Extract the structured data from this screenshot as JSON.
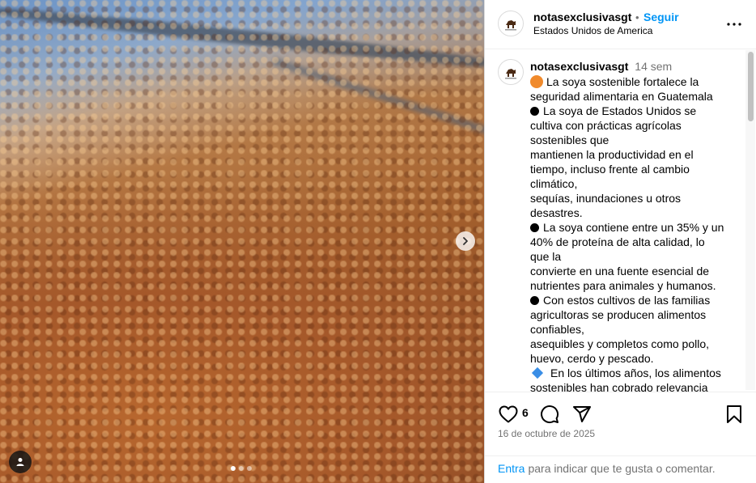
{
  "post": {
    "username": "notasexclusivasgt",
    "separator": "•",
    "follow_label": "Seguir",
    "location": "Estados Unidos de America"
  },
  "media": {
    "slide_count": 3,
    "active_slide": 1
  },
  "comment": {
    "username": "notasexclusivasgt",
    "time": "14 sem",
    "lines": [
      "La soya sostenible fortalece la",
      "seguridad alimentaria en Guatemala",
      "La soya de Estados Unidos se",
      "cultiva con prácticas agrícolas",
      "sostenibles que",
      "mantienen la productividad en el",
      "tiempo, incluso frente al cambio",
      "climático,",
      "sequías, inundaciones u otros",
      "desastres.",
      "La soya contiene entre un 35% y un",
      "40% de proteína de alta calidad, lo",
      "que la",
      "convierte en una fuente esencial de",
      "nutrientes para animales y humanos.",
      "Con estos cultivos de las familias",
      "agricultoras se producen alimentos",
      "confiables,",
      "asequibles y completos como pollo,",
      "huevo, cerdo y pescado.",
      "En los últimos años, los alimentos",
      "sostenibles han cobrado relevancia"
    ]
  },
  "actions": {
    "like_count": "6",
    "date": "16 de octubre de 2025"
  },
  "add_comment": {
    "enter_label": "Entra",
    "rest_text": "para indicar que te gusta o comentar."
  },
  "icons": {
    "like": "heart-icon",
    "comment": "comment-icon",
    "share": "paper-plane-icon",
    "save": "bookmark-icon",
    "more": "more-icon",
    "next": "chevron-right-icon",
    "tagged": "user-icon"
  },
  "colors": {
    "accent": "#0095f6",
    "muted": "#737373",
    "orange_emoji": "#f08a2c",
    "blue_diamond": "#3a8ee6"
  }
}
